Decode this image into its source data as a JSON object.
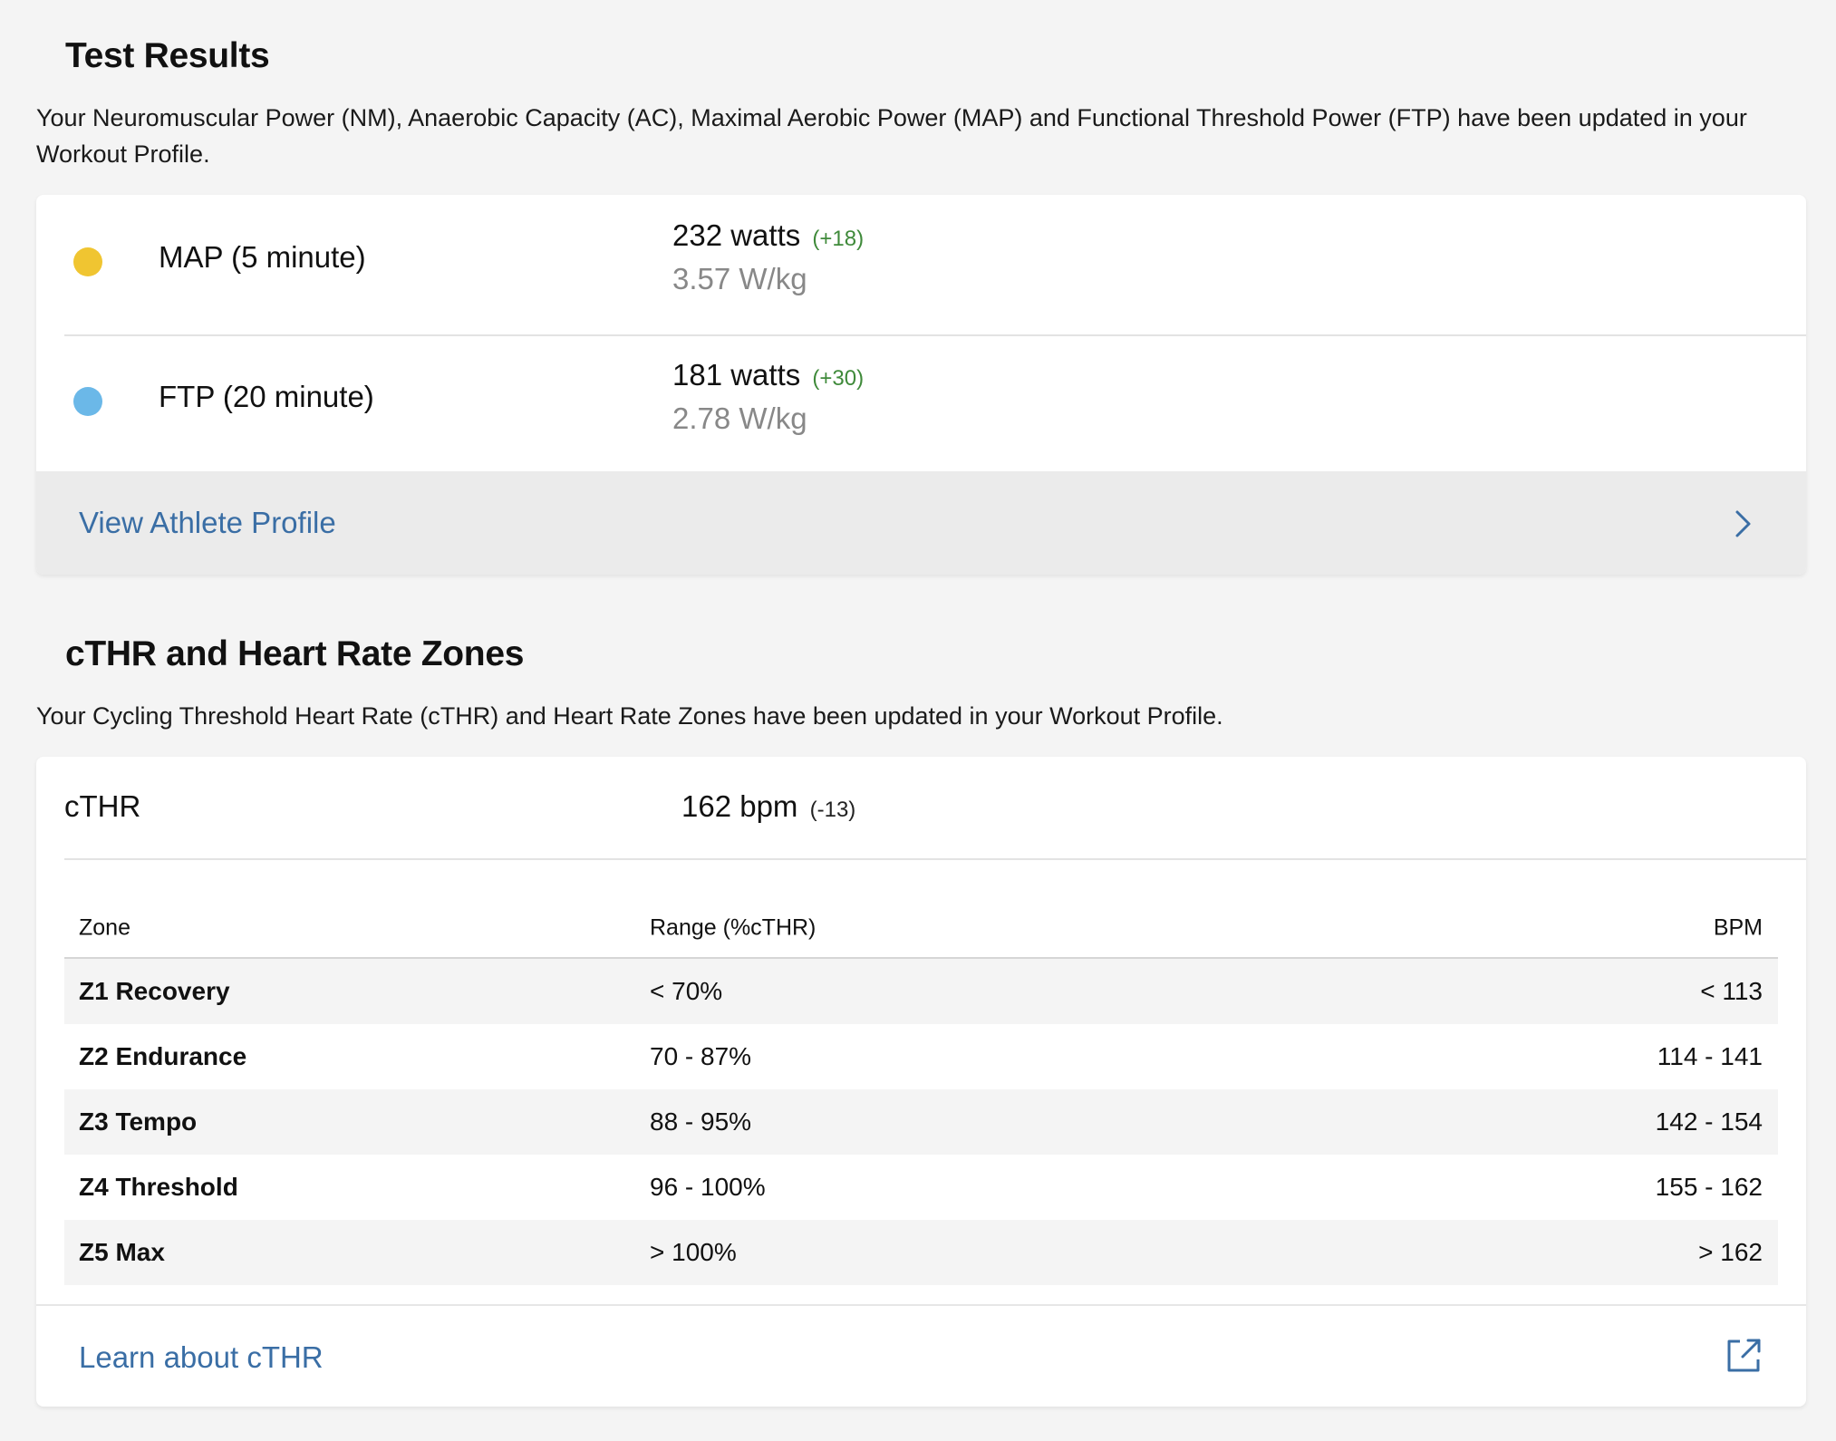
{
  "test_results": {
    "title": "Test Results",
    "description": "Your Neuromuscular Power (NM), Anaerobic Capacity (AC), Maximal Aerobic Power (MAP) and Functional Threshold Power (FTP) have been updated in your Workout Profile.",
    "metrics": [
      {
        "name": "MAP (5 minute)",
        "watts": "232 watts",
        "delta": "(+18)",
        "wkg": "3.57 W/kg",
        "dot_color": "#f0c531"
      },
      {
        "name": "FTP (20 minute)",
        "watts": "181 watts",
        "delta": "(+30)",
        "wkg": "2.78 W/kg",
        "dot_color": "#6bb8e8"
      }
    ],
    "profile_link": "View Athlete Profile",
    "profile_link_icon": "chevron-right-icon"
  },
  "cthr": {
    "title": "cTHR and Heart Rate Zones",
    "description": "Your Cycling Threshold Heart Rate (cTHR) and Heart Rate Zones have been updated in your Workout Profile.",
    "label": "cTHR",
    "value": "162 bpm",
    "delta": "(-13)",
    "table": {
      "headers": [
        "Zone",
        "Range (%cTHR)",
        "BPM"
      ],
      "rows": [
        {
          "zone": "Z1 Recovery",
          "range": "< 70%",
          "bpm": "< 113"
        },
        {
          "zone": "Z2 Endurance",
          "range": "70 - 87%",
          "bpm": "114 - 141"
        },
        {
          "zone": "Z3 Tempo",
          "range": "88 - 95%",
          "bpm": "142 - 154"
        },
        {
          "zone": "Z4 Threshold",
          "range": "96 - 100%",
          "bpm": "155 - 162"
        },
        {
          "zone": "Z5 Max",
          "range": "> 100%",
          "bpm": "> 162"
        }
      ]
    },
    "learn_link": "Learn about cTHR",
    "learn_link_icon": "external-link-icon"
  },
  "colors": {
    "link": "#3a6ea5",
    "positive_delta": "#3f8a3a",
    "background": "#f4f4f4"
  }
}
